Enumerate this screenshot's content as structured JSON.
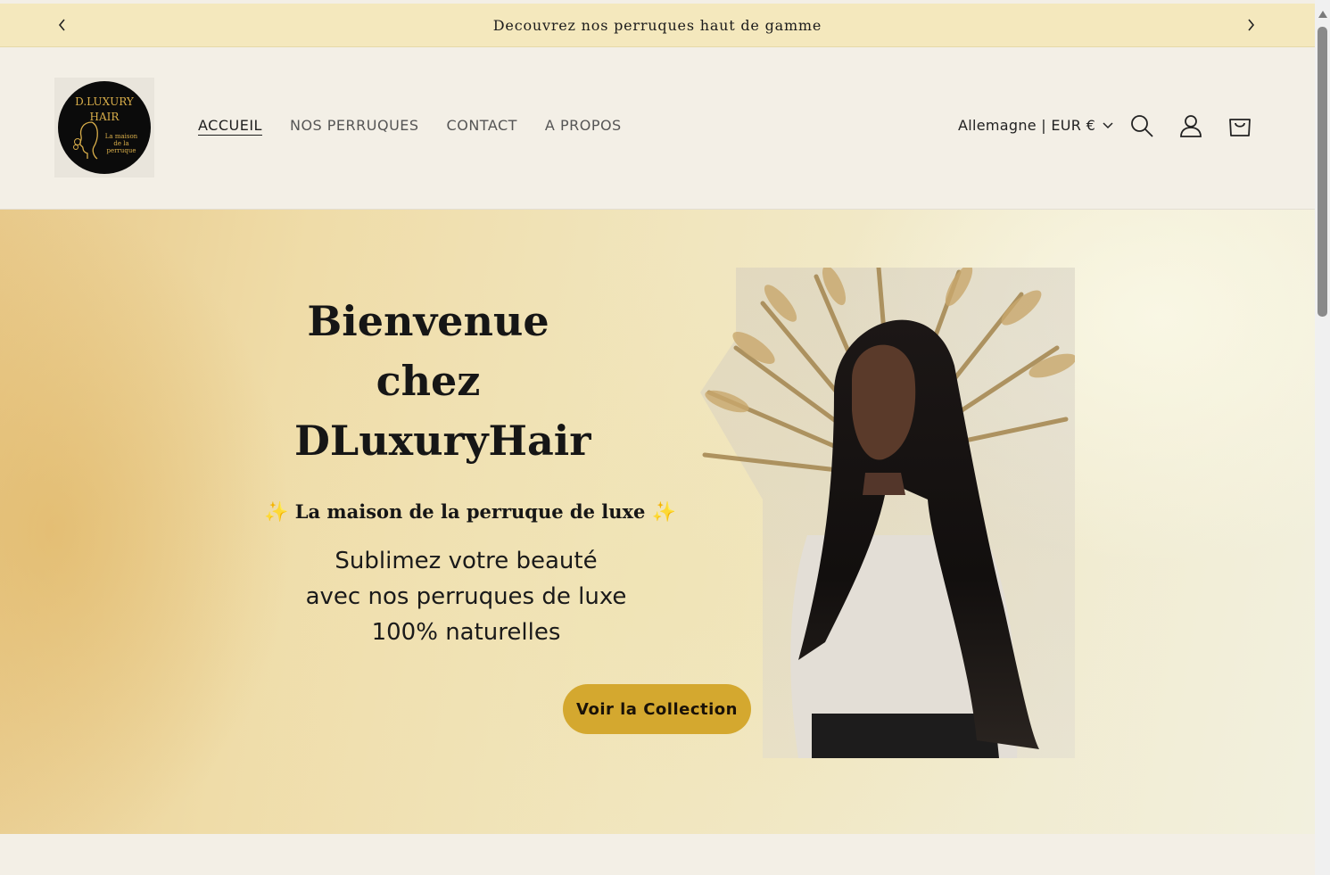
{
  "announcement": {
    "text": "Decouvrez nos perruques haut de gamme",
    "prev_icon": "chevron-left-icon",
    "next_icon": "chevron-right-icon"
  },
  "header": {
    "logo": {
      "line1": "D.LUXURY",
      "line2": "HAIR",
      "subtitle": "La maison de la perruque"
    },
    "nav": [
      {
        "label": "ACCUEIL",
        "active": true
      },
      {
        "label": "NOS PERRUQUES",
        "active": false
      },
      {
        "label": "CONTACT",
        "active": false
      },
      {
        "label": "A PROPOS",
        "active": false
      }
    ],
    "locale": "Allemagne | EUR €",
    "icons": [
      "search-icon",
      "account-icon",
      "cart-icon"
    ]
  },
  "hero": {
    "title_lines": [
      "Bienvenue",
      "chez",
      "DLuxuryHair"
    ],
    "tagline": "La maison de la perruque de luxe",
    "sparkle": "✨",
    "description_lines": [
      "Sublimez votre beauté",
      "avec nos perruques de luxe",
      "100% naturelles"
    ],
    "cta_label": "Voir la Collection"
  },
  "colors": {
    "announcement_bg": "#f4e8bd",
    "page_bg": "#f3efe6",
    "cta_bg": "#d4a82f",
    "logo_gold": "#d9ae4a"
  }
}
